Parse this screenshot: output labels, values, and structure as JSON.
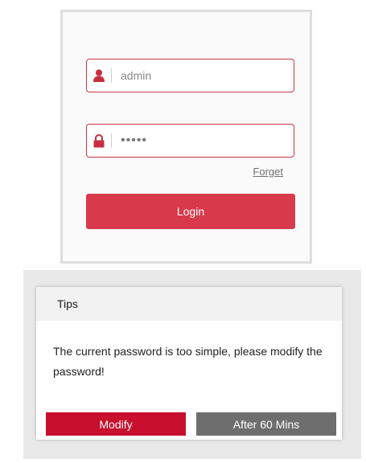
{
  "login": {
    "username": "admin",
    "password_masked": "•••••",
    "forget_label": "Forget",
    "login_label": "Login"
  },
  "icons": {
    "user": "user-icon",
    "lock": "lock-icon"
  },
  "colors": {
    "accent": "#d93a4b",
    "modify_button": "#c8102e",
    "later_button": "#6e6e6e",
    "field_border": "#cc3344"
  },
  "dialog": {
    "title": "Tips",
    "message": "The current password is too simple, please modify the password!",
    "modify_label": "Modify",
    "later_label": "After 60 Mins"
  }
}
